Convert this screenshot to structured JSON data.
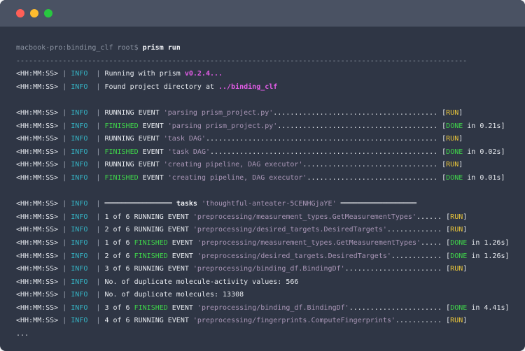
{
  "window": {
    "controls": [
      {
        "name": "close",
        "color": "#ff5f57"
      },
      {
        "name": "minimize",
        "color": "#febc2e"
      },
      {
        "name": "maximize",
        "color": "#28c840"
      }
    ]
  },
  "terminal": {
    "lines": [
      [
        {
          "t": "macbook-pro:binding_clf root$ ",
          "c": "dim"
        },
        {
          "t": "prism run",
          "c": "w"
        }
      ],
      [
        {
          "t": "-----------------------------------------------------------------------------------------------------------",
          "c": "dim"
        }
      ],
      [
        {
          "t": "<HH:MM:SS>",
          "c": "ts"
        },
        {
          "t": " | ",
          "c": "pipe"
        },
        {
          "t": "INFO ",
          "c": "info"
        },
        {
          "t": " | ",
          "c": "pipe"
        },
        {
          "t": "Running with prism ",
          "c": "txt"
        },
        {
          "t": "v0.2.4...",
          "c": "mag"
        }
      ],
      [
        {
          "t": "<HH:MM:SS>",
          "c": "ts"
        },
        {
          "t": " | ",
          "c": "pipe"
        },
        {
          "t": "INFO ",
          "c": "info"
        },
        {
          "t": " | ",
          "c": "pipe"
        },
        {
          "t": "Found project directory at ",
          "c": "txt"
        },
        {
          "t": "../binding_clf",
          "c": "mag"
        }
      ],
      [],
      [
        {
          "t": "<HH:MM:SS>",
          "c": "ts"
        },
        {
          "t": " | ",
          "c": "pipe"
        },
        {
          "t": "INFO ",
          "c": "info"
        },
        {
          "t": " | ",
          "c": "pipe"
        },
        {
          "t": "RUNNING EVENT ",
          "c": "txt"
        },
        {
          "t": "'parsing prism_project.py'",
          "c": "str"
        },
        {
          "t": "....................................... ",
          "c": "txt"
        },
        {
          "t": "[",
          "c": "txt"
        },
        {
          "t": "RUN",
          "c": "yel"
        },
        {
          "t": "]",
          "c": "txt"
        }
      ],
      [
        {
          "t": "<HH:MM:SS>",
          "c": "ts"
        },
        {
          "t": " | ",
          "c": "pipe"
        },
        {
          "t": "INFO ",
          "c": "info"
        },
        {
          "t": " | ",
          "c": "pipe"
        },
        {
          "t": "FINISHED",
          "c": "grn"
        },
        {
          "t": " EVENT ",
          "c": "txt"
        },
        {
          "t": "'parsing prism_project.py'",
          "c": "str"
        },
        {
          "t": "...................................... ",
          "c": "txt"
        },
        {
          "t": "[",
          "c": "txt"
        },
        {
          "t": "DONE",
          "c": "grn"
        },
        {
          "t": " in 0.21s]",
          "c": "txt"
        }
      ],
      [
        {
          "t": "<HH:MM:SS>",
          "c": "ts"
        },
        {
          "t": " | ",
          "c": "pipe"
        },
        {
          "t": "INFO ",
          "c": "info"
        },
        {
          "t": " | ",
          "c": "pipe"
        },
        {
          "t": "RUNNING EVENT ",
          "c": "txt"
        },
        {
          "t": "'task DAG'",
          "c": "str"
        },
        {
          "t": "....................................................... ",
          "c": "txt"
        },
        {
          "t": "[",
          "c": "txt"
        },
        {
          "t": "RUN",
          "c": "yel"
        },
        {
          "t": "]",
          "c": "txt"
        }
      ],
      [
        {
          "t": "<HH:MM:SS>",
          "c": "ts"
        },
        {
          "t": " | ",
          "c": "pipe"
        },
        {
          "t": "INFO ",
          "c": "info"
        },
        {
          "t": " | ",
          "c": "pipe"
        },
        {
          "t": "FINISHED",
          "c": "grn"
        },
        {
          "t": " EVENT ",
          "c": "txt"
        },
        {
          "t": "'task DAG'",
          "c": "str"
        },
        {
          "t": "...................................................... ",
          "c": "txt"
        },
        {
          "t": "[",
          "c": "txt"
        },
        {
          "t": "DONE",
          "c": "grn"
        },
        {
          "t": " in 0.02s]",
          "c": "txt"
        }
      ],
      [
        {
          "t": "<HH:MM:SS>",
          "c": "ts"
        },
        {
          "t": " | ",
          "c": "pipe"
        },
        {
          "t": "INFO ",
          "c": "info"
        },
        {
          "t": " | ",
          "c": "pipe"
        },
        {
          "t": "RUNNING EVENT ",
          "c": "txt"
        },
        {
          "t": "'creating pipeline, DAG executor'",
          "c": "str"
        },
        {
          "t": "................................ ",
          "c": "txt"
        },
        {
          "t": "[",
          "c": "txt"
        },
        {
          "t": "RUN",
          "c": "yel"
        },
        {
          "t": "]",
          "c": "txt"
        }
      ],
      [
        {
          "t": "<HH:MM:SS>",
          "c": "ts"
        },
        {
          "t": " | ",
          "c": "pipe"
        },
        {
          "t": "INFO ",
          "c": "info"
        },
        {
          "t": " | ",
          "c": "pipe"
        },
        {
          "t": "FINISHED",
          "c": "grn"
        },
        {
          "t": " EVENT ",
          "c": "txt"
        },
        {
          "t": "'creating pipeline, DAG executor'",
          "c": "str"
        },
        {
          "t": "............................... ",
          "c": "txt"
        },
        {
          "t": "[",
          "c": "txt"
        },
        {
          "t": "DONE",
          "c": "grn"
        },
        {
          "t": " in 0.01s]",
          "c": "txt"
        }
      ],
      [],
      [
        {
          "t": "<HH:MM:SS>",
          "c": "ts"
        },
        {
          "t": " | ",
          "c": "pipe"
        },
        {
          "t": "INFO ",
          "c": "info"
        },
        {
          "t": " | ",
          "c": "pipe"
        },
        {
          "t": "════════════════ ",
          "c": "rule"
        },
        {
          "t": "tasks ",
          "c": "w"
        },
        {
          "t": "'thoughtful-anteater-5CENHGjaYE'",
          "c": "str"
        },
        {
          "t": " ══════════════════",
          "c": "rule"
        }
      ],
      [
        {
          "t": "<HH:MM:SS>",
          "c": "ts"
        },
        {
          "t": " | ",
          "c": "pipe"
        },
        {
          "t": "INFO ",
          "c": "info"
        },
        {
          "t": " | ",
          "c": "pipe"
        },
        {
          "t": "1 of 6 RUNNING EVENT ",
          "c": "txt"
        },
        {
          "t": "'preprocessing/measurement_types.GetMeasurementTypes'",
          "c": "str"
        },
        {
          "t": "...... ",
          "c": "txt"
        },
        {
          "t": "[",
          "c": "txt"
        },
        {
          "t": "RUN",
          "c": "yel"
        },
        {
          "t": "]",
          "c": "txt"
        }
      ],
      [
        {
          "t": "<HH:MM:SS>",
          "c": "ts"
        },
        {
          "t": " | ",
          "c": "pipe"
        },
        {
          "t": "INFO ",
          "c": "info"
        },
        {
          "t": " | ",
          "c": "pipe"
        },
        {
          "t": "2 of 6 RUNNING EVENT ",
          "c": "txt"
        },
        {
          "t": "'preprocessing/desired_targets.DesiredTargets'",
          "c": "str"
        },
        {
          "t": "............. ",
          "c": "txt"
        },
        {
          "t": "[",
          "c": "txt"
        },
        {
          "t": "RUN",
          "c": "yel"
        },
        {
          "t": "]",
          "c": "txt"
        }
      ],
      [
        {
          "t": "<HH:MM:SS>",
          "c": "ts"
        },
        {
          "t": " | ",
          "c": "pipe"
        },
        {
          "t": "INFO ",
          "c": "info"
        },
        {
          "t": " | ",
          "c": "pipe"
        },
        {
          "t": "1 of 6 ",
          "c": "txt"
        },
        {
          "t": "FINISHED",
          "c": "grn"
        },
        {
          "t": " EVENT ",
          "c": "txt"
        },
        {
          "t": "'preprocessing/measurement_types.GetMeasurementTypes'",
          "c": "str"
        },
        {
          "t": "..... ",
          "c": "txt"
        },
        {
          "t": "[",
          "c": "txt"
        },
        {
          "t": "DONE",
          "c": "grn"
        },
        {
          "t": " in 1.26s]",
          "c": "txt"
        }
      ],
      [
        {
          "t": "<HH:MM:SS>",
          "c": "ts"
        },
        {
          "t": " | ",
          "c": "pipe"
        },
        {
          "t": "INFO ",
          "c": "info"
        },
        {
          "t": " | ",
          "c": "pipe"
        },
        {
          "t": "2 of 6 ",
          "c": "txt"
        },
        {
          "t": "FINISHED",
          "c": "grn"
        },
        {
          "t": " EVENT ",
          "c": "txt"
        },
        {
          "t": "'preprocessing/desired_targets.DesiredTargets'",
          "c": "str"
        },
        {
          "t": "............ ",
          "c": "txt"
        },
        {
          "t": "[",
          "c": "txt"
        },
        {
          "t": "DONE",
          "c": "grn"
        },
        {
          "t": " in 1.26s]",
          "c": "txt"
        }
      ],
      [
        {
          "t": "<HH:MM:SS>",
          "c": "ts"
        },
        {
          "t": " | ",
          "c": "pipe"
        },
        {
          "t": "INFO ",
          "c": "info"
        },
        {
          "t": " | ",
          "c": "pipe"
        },
        {
          "t": "3 of 6 RUNNING EVENT ",
          "c": "txt"
        },
        {
          "t": "'preprocessing/binding_df.BindingDf'",
          "c": "str"
        },
        {
          "t": "....................... ",
          "c": "txt"
        },
        {
          "t": "[",
          "c": "txt"
        },
        {
          "t": "RUN",
          "c": "yel"
        },
        {
          "t": "]",
          "c": "txt"
        }
      ],
      [
        {
          "t": "<HH:MM:SS>",
          "c": "ts"
        },
        {
          "t": " | ",
          "c": "pipe"
        },
        {
          "t": "INFO ",
          "c": "info"
        },
        {
          "t": " | ",
          "c": "pipe"
        },
        {
          "t": "No. of duplicate molecule-activity values: 566",
          "c": "txt"
        }
      ],
      [
        {
          "t": "<HH:MM:SS>",
          "c": "ts"
        },
        {
          "t": " | ",
          "c": "pipe"
        },
        {
          "t": "INFO ",
          "c": "info"
        },
        {
          "t": " | ",
          "c": "pipe"
        },
        {
          "t": "No. of duplicate molecules: 13308",
          "c": "txt"
        }
      ],
      [
        {
          "t": "<HH:MM:SS>",
          "c": "ts"
        },
        {
          "t": " | ",
          "c": "pipe"
        },
        {
          "t": "INFO ",
          "c": "info"
        },
        {
          "t": " | ",
          "c": "pipe"
        },
        {
          "t": "3 of 6 ",
          "c": "txt"
        },
        {
          "t": "FINISHED",
          "c": "grn"
        },
        {
          "t": " EVENT ",
          "c": "txt"
        },
        {
          "t": "'preprocessing/binding_df.BindingDf'",
          "c": "str"
        },
        {
          "t": "...................... ",
          "c": "txt"
        },
        {
          "t": "[",
          "c": "txt"
        },
        {
          "t": "DONE",
          "c": "grn"
        },
        {
          "t": " in 4.41s]",
          "c": "txt"
        }
      ],
      [
        {
          "t": "<HH:MM:SS>",
          "c": "ts"
        },
        {
          "t": " | ",
          "c": "pipe"
        },
        {
          "t": "INFO ",
          "c": "info"
        },
        {
          "t": " | ",
          "c": "pipe"
        },
        {
          "t": "4 of 6 RUNNING EVENT ",
          "c": "txt"
        },
        {
          "t": "'preprocessing/fingerprints.ComputeFingerprints'",
          "c": "str"
        },
        {
          "t": "........... ",
          "c": "txt"
        },
        {
          "t": "[",
          "c": "txt"
        },
        {
          "t": "RUN",
          "c": "yel"
        },
        {
          "t": "]",
          "c": "txt"
        }
      ],
      [
        {
          "t": "...",
          "c": "txt"
        }
      ]
    ]
  }
}
